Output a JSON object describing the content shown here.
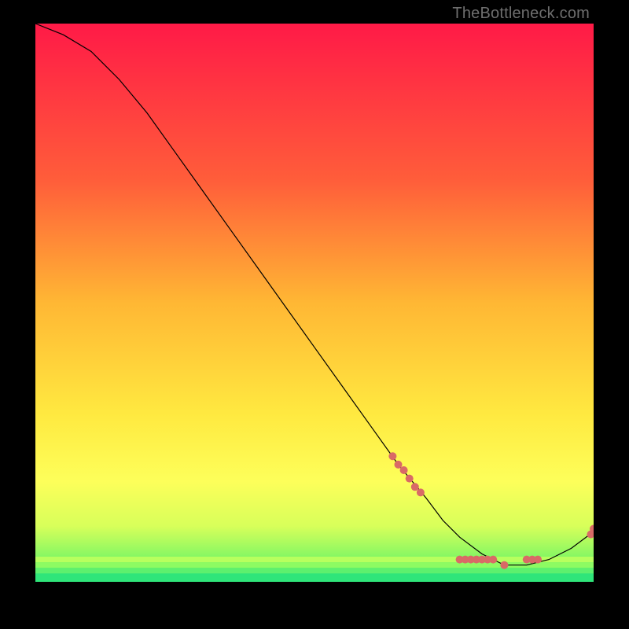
{
  "watermark": "TheBottleneck.com",
  "chart_data": {
    "type": "line",
    "title": "",
    "xlabel": "",
    "ylabel": "",
    "xlim": [
      0,
      100
    ],
    "ylim": [
      0,
      100
    ],
    "grid": false,
    "line": {
      "x": [
        0,
        5,
        10,
        15,
        20,
        25,
        30,
        35,
        40,
        45,
        50,
        55,
        60,
        65,
        70,
        73,
        76,
        80,
        84,
        88,
        92,
        96,
        100
      ],
      "y": [
        100,
        98,
        95,
        90,
        84,
        77,
        70,
        63,
        56,
        49,
        42,
        35,
        28,
        21,
        15,
        11,
        8,
        5,
        3,
        3,
        4,
        6,
        9
      ],
      "color": "#000000",
      "width": 1.2
    },
    "scatter": {
      "x": [
        64,
        65,
        66,
        67,
        68,
        69,
        76,
        77,
        78,
        79,
        80,
        81,
        82,
        84,
        88,
        89,
        90,
        99.5,
        100
      ],
      "y": [
        22.5,
        21,
        20,
        18.5,
        17,
        16,
        4,
        4,
        4,
        4,
        4,
        4,
        4,
        3,
        4,
        4,
        4,
        8.5,
        9.5
      ],
      "color": "#d96a66",
      "size": 5
    },
    "background_gradient": {
      "stops": [
        {
          "offset": 0.0,
          "color": "#ff1a47"
        },
        {
          "offset": 0.28,
          "color": "#ff5d3a"
        },
        {
          "offset": 0.5,
          "color": "#ffb734"
        },
        {
          "offset": 0.7,
          "color": "#ffe940"
        },
        {
          "offset": 0.82,
          "color": "#fdff5a"
        },
        {
          "offset": 0.9,
          "color": "#d8ff5a"
        },
        {
          "offset": 0.955,
          "color": "#86f763"
        },
        {
          "offset": 1.0,
          "color": "#2fe57a"
        }
      ],
      "bottom_bands": [
        {
          "y0": 0.955,
          "y1": 0.965,
          "color": "#b7ff5e"
        },
        {
          "y0": 0.965,
          "y1": 0.975,
          "color": "#8dfb62"
        },
        {
          "y0": 0.975,
          "y1": 0.985,
          "color": "#5df06e"
        },
        {
          "y0": 0.985,
          "y1": 1.0,
          "color": "#2fe57a"
        }
      ]
    }
  }
}
